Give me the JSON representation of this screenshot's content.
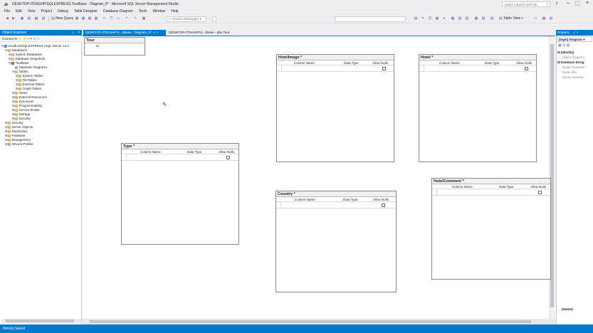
{
  "window": {
    "title": "DESKTOP-ITDASHP\\SQLEXPRESS.TourBase - Diagram_0* - Microsoft SQL Server Management Studio",
    "quick_launch_placeholder": "Quick Launch (Ctrl+Q)"
  },
  "menu": [
    "File",
    "Edit",
    "View",
    "Project",
    "Debug",
    "Table Designer",
    "Database Diagram",
    "Tools",
    "Window",
    "Help"
  ],
  "toolbar": {
    "new_query": "New Query",
    "debugger": "Generic Debugger",
    "table_view": "Table View"
  },
  "object_explorer": {
    "title": "Object Explorer",
    "connect": "Connect",
    "tree": [
      {
        "level": 0,
        "label": "localhost\\SQLEXPRESS (SQL Server 14.0",
        "kind": "server",
        "expanded": true
      },
      {
        "level": 1,
        "label": "Databases",
        "kind": "folder",
        "expanded": true
      },
      {
        "level": 2,
        "label": "System Databases",
        "kind": "folder",
        "expanded": false
      },
      {
        "level": 2,
        "label": "Database Snapshots",
        "kind": "folder",
        "expanded": false
      },
      {
        "level": 2,
        "label": "TourBase",
        "kind": "db",
        "expanded": true
      },
      {
        "level": 3,
        "label": "Database Diagrams",
        "kind": "diagram",
        "expanded": null
      },
      {
        "level": 3,
        "label": "Tables",
        "kind": "folder",
        "expanded": true
      },
      {
        "level": 4,
        "label": "System Tables",
        "kind": "folder",
        "expanded": false
      },
      {
        "level": 4,
        "label": "FileTables",
        "kind": "folder",
        "expanded": false
      },
      {
        "level": 4,
        "label": "External Tables",
        "kind": "folder",
        "expanded": false
      },
      {
        "level": 4,
        "label": "Graph Tables",
        "kind": "folder",
        "expanded": false
      },
      {
        "level": 3,
        "label": "Views",
        "kind": "folder",
        "expanded": false
      },
      {
        "level": 3,
        "label": "External Resources",
        "kind": "folder",
        "expanded": false
      },
      {
        "level": 3,
        "label": "Synonyms",
        "kind": "folder",
        "expanded": false
      },
      {
        "level": 3,
        "label": "Programmability",
        "kind": "folder",
        "expanded": false
      },
      {
        "level": 3,
        "label": "Service Broker",
        "kind": "folder",
        "expanded": false
      },
      {
        "level": 3,
        "label": "Storage",
        "kind": "folder",
        "expanded": false
      },
      {
        "level": 3,
        "label": "Security",
        "kind": "folder",
        "expanded": false
      },
      {
        "level": 1,
        "label": "Security",
        "kind": "folder",
        "expanded": false
      },
      {
        "level": 1,
        "label": "Server Objects",
        "kind": "folder",
        "expanded": false
      },
      {
        "level": 1,
        "label": "Replication",
        "kind": "folder",
        "expanded": false
      },
      {
        "level": 1,
        "label": "PolyBase",
        "kind": "folder",
        "expanded": false
      },
      {
        "level": 1,
        "label": "Management",
        "kind": "folder",
        "expanded": false
      },
      {
        "level": 1,
        "label": "XEvent Profiler",
        "kind": "xevent",
        "expanded": false
      }
    ]
  },
  "tabs": [
    {
      "label": "DESKTOP-ITDASHP\\S...dBase - Diagram_0*",
      "active": true
    },
    {
      "label": "DESKTOP-ITDASHP\\S...rBase - dbo.Tour",
      "active": false
    }
  ],
  "diagram": {
    "column_headers": {
      "name": "Column Name",
      "type": "Data Type",
      "nulls": "Allow Nulls"
    },
    "tour_table": {
      "title": "Tour",
      "column": "Id"
    },
    "tables": {
      "hotelimage": "HotelImage *",
      "hotel": "Hotel *",
      "type": "Type *",
      "country": "Country *",
      "hotelcomment": "HotelComment *"
    }
  },
  "properties": {
    "title": "Properti...",
    "selector": "[Dgm] Diagram",
    "identity": "(Identity)",
    "name_key": "(Name",
    "name_val": "Diagram",
    "db_group": "Database Desig",
    "db_key": "Datab",
    "db_val": "TourBase",
    "owner_key": "Owne",
    "owner_val": "dbo",
    "server_key": "Server",
    "server_val": "desktop-",
    "footer": "(Name)"
  },
  "status": {
    "text": "Item(s) Saved"
  }
}
